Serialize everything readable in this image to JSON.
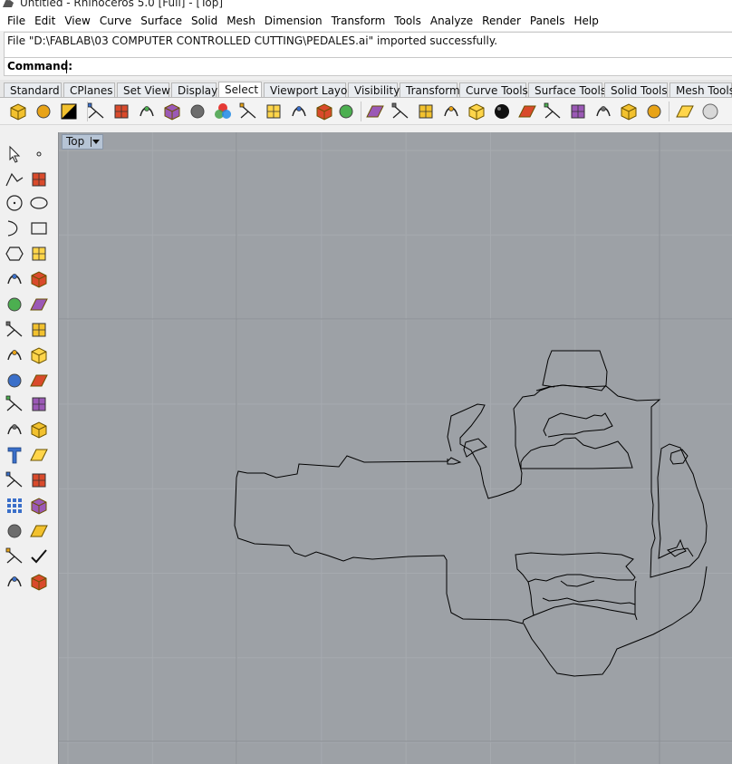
{
  "window": {
    "title": "Untitled - Rhinoceros 5.0 [Full] - [Top]"
  },
  "menu": [
    "File",
    "Edit",
    "View",
    "Curve",
    "Surface",
    "Solid",
    "Mesh",
    "Dimension",
    "Transform",
    "Tools",
    "Analyze",
    "Render",
    "Panels",
    "Help"
  ],
  "command": {
    "history": "File \"D:\\FABLAB\\03 COMPUTER CONTROLLED CUTTING\\PEDALES.ai\" imported successfully.",
    "prompt": "Command:",
    "value": ""
  },
  "tabs": [
    "Standard",
    "CPlanes",
    "Set View",
    "Display",
    "Select",
    "Viewport Layout",
    "Visibility",
    "Transform",
    "Curve Tools",
    "Surface Tools",
    "Solid Tools",
    "Mesh Tools"
  ],
  "active_tab": "Select",
  "toolbar_icons": [
    "select-all-icon",
    "select-none-icon",
    "invert-selection-icon",
    "select-last-icon",
    "select-previous-icon",
    "select-by-id-icon",
    "select-by-name-icon",
    "select-objects-icon",
    "select-by-color-icon",
    "select-by-layer-icon",
    "select-points-icon",
    "select-point-cloud-icon",
    "select-curves-icon",
    "select-open-curves-icon",
    "select-hatch-icon",
    "select-dimensions-icon",
    "select-annotation-icon",
    "select-lights-icon",
    "select-polysurfaces-icon",
    "select-surfaces-icon",
    "select-planar-surfaces-icon",
    "select-meshes-icon",
    "select-blocks-icon",
    "select-groups-icon",
    "select-duplicates-icon",
    "select-render-meshes-icon",
    "select-brep-icon",
    "select-sphere-icon"
  ],
  "sidebar_icons": [
    [
      "select-arrow-icon",
      "point-icon"
    ],
    [
      "polyline-icon",
      "curve-control-points-icon"
    ],
    [
      "circle-icon",
      "ellipse-icon"
    ],
    [
      "arc-icon",
      "rectangle-icon"
    ],
    [
      "polygon-icon",
      "fillet-curve-icon"
    ],
    [
      "surface-from-points-icon",
      "loft-icon"
    ],
    [
      "box-icon",
      "sphere-icon"
    ],
    [
      "cylinder-icon",
      "mesh-icon"
    ],
    [
      "boolean-union-icon",
      "explode-icon"
    ],
    [
      "trim-icon",
      "split-icon"
    ],
    [
      "group-icon",
      "ungroup-icon"
    ],
    [
      "fillet-icon",
      "offset-icon"
    ],
    [
      "text-icon",
      "dimension-icon"
    ],
    [
      "block-icon",
      "insert-icon"
    ],
    [
      "array-icon",
      "distribute-icon"
    ],
    [
      "point-cloud-icon",
      "orient-icon"
    ],
    [
      "extrude-icon",
      "check-icon"
    ],
    [
      "render-icon",
      "material-icon"
    ]
  ],
  "viewport": {
    "name": "Top",
    "background": "#9da1a6",
    "grid_minor": "#a6aaaf",
    "grid_major": "#8c9095",
    "curve_color": "#000000"
  }
}
